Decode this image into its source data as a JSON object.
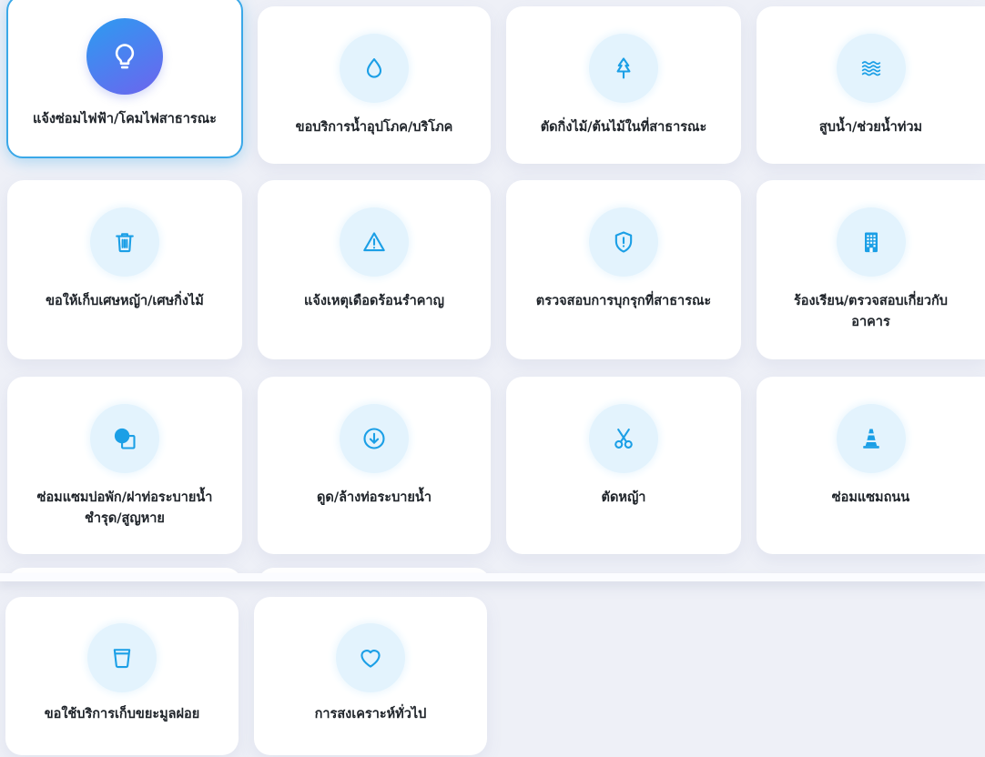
{
  "colors": {
    "accent": "#1b9fe6",
    "icon_bg": "#e3f3fd",
    "selected_gradient_start": "#2c9cf1",
    "selected_gradient_end": "#6d64ee",
    "selected_border": "#3aa8e8",
    "page_bg": "#eef0f7",
    "card_bg": "#ffffff",
    "text": "#1e2329"
  },
  "services": [
    {
      "label_lines": [
        "แจ้งซ่อมไฟฟ้า/โคมไฟสาธารณะ"
      ],
      "icon": "lightbulb-icon",
      "selected": true
    },
    {
      "label_lines": [
        "ขอบริการน้ำอุปโภค/บริโภค"
      ],
      "icon": "water-drop-icon",
      "selected": false
    },
    {
      "label_lines": [
        "ตัดกิ่งไม้/ต้นไม้ในที่สาธารณะ"
      ],
      "icon": "tree-icon",
      "selected": false
    },
    {
      "label_lines": [
        "สูบน้ำ/ช่วยน้ำท่วม"
      ],
      "icon": "waves-icon",
      "selected": false
    },
    {
      "label_lines": [
        "ขอให้เก็บเศษหญ้า/เศษกิ่งไม้"
      ],
      "icon": "trash-icon",
      "selected": false
    },
    {
      "label_lines": [
        "แจ้งเหตุเดือดร้อนรำคาญ"
      ],
      "icon": "warning-icon",
      "selected": false
    },
    {
      "label_lines": [
        "ตรวจสอบการบุกรุกที่สาธารณะ"
      ],
      "icon": "shield-alert-icon",
      "selected": false
    },
    {
      "label_lines": [
        "ร้องเรียน/ตรวจสอบเกี่ยวกับ",
        "อาคาร"
      ],
      "icon": "building-icon",
      "selected": false
    },
    {
      "label_lines": [
        "ซ่อมแซมบ่อพัก/ฝาท่อระบายน้ำ",
        "ชำรุด/สูญหาย"
      ],
      "icon": "shapes-icon",
      "selected": false
    },
    {
      "label_lines": [
        "ดูด/ล้างท่อระบายน้ำ"
      ],
      "icon": "arrow-down-circle-icon",
      "selected": false
    },
    {
      "label_lines": [
        "ตัดหญ้า"
      ],
      "icon": "scissors-icon",
      "selected": false
    },
    {
      "label_lines": [
        "ซ่อมแซมถนน"
      ],
      "icon": "traffic-cone-icon",
      "selected": false
    },
    {
      "label_lines": [
        "ขอใช้บริการเก็บขยะมูลฝอย"
      ],
      "icon": "bin-icon",
      "selected": false
    },
    {
      "label_lines": [
        "การสงเคราะห์ทั่วไป"
      ],
      "icon": "heart-icon",
      "selected": false
    }
  ]
}
